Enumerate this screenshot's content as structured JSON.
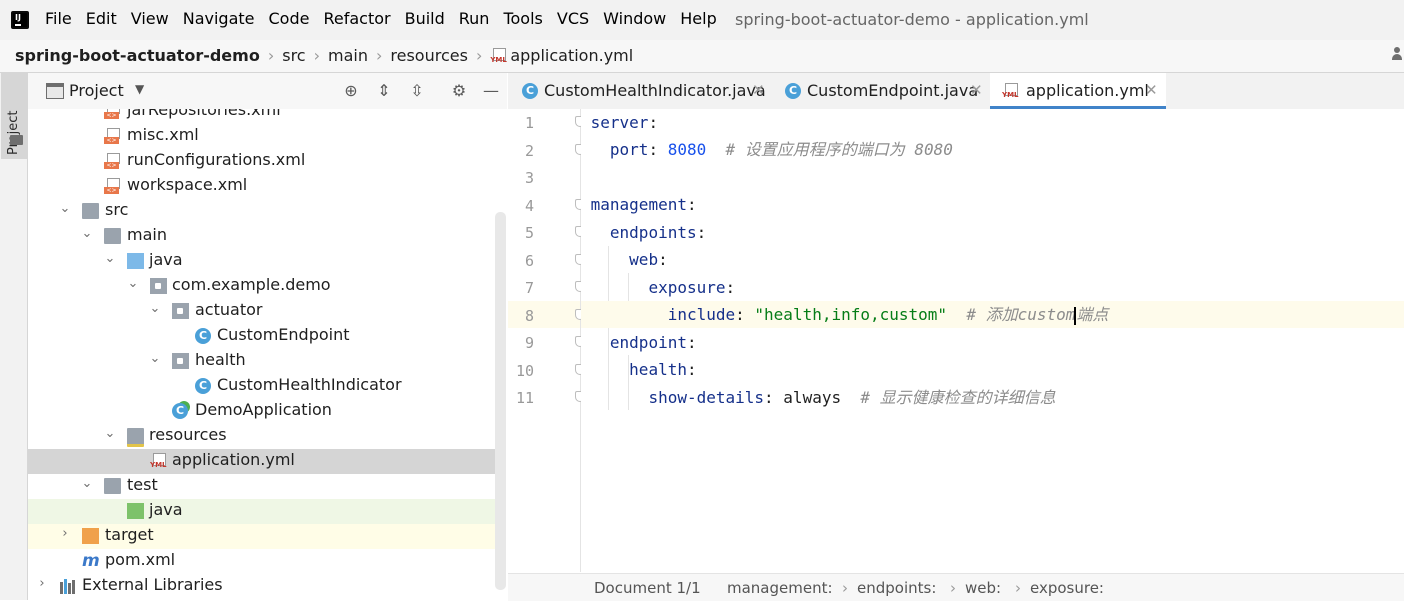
{
  "menubar": {
    "items": [
      "File",
      "Edit",
      "View",
      "Navigate",
      "Code",
      "Refactor",
      "Build",
      "Run",
      "Tools",
      "VCS",
      "Window",
      "Help"
    ],
    "window_title": "spring-boot-actuator-demo - application.yml"
  },
  "breadcrumb": {
    "project": "spring-boot-actuator-demo",
    "parts": [
      "src",
      "main",
      "resources"
    ],
    "file": "application.yml"
  },
  "toolstrip": {
    "project_tab": "Project"
  },
  "project_panel": {
    "title": "Project",
    "tree": [
      {
        "label": "jarRepositories.xml",
        "icon": "xml-file-icon"
      },
      {
        "label": "misc.xml",
        "icon": "xml-file-icon"
      },
      {
        "label": "runConfigurations.xml",
        "icon": "xml-file-icon"
      },
      {
        "label": "workspace.xml",
        "icon": "xml-file-icon"
      },
      {
        "label": "src",
        "icon": "folder-icon"
      },
      {
        "label": "main",
        "icon": "folder-icon"
      },
      {
        "label": "java",
        "icon": "source-folder-icon"
      },
      {
        "label": "com.example.demo",
        "icon": "package-icon"
      },
      {
        "label": "actuator",
        "icon": "package-icon"
      },
      {
        "label": "CustomEndpoint",
        "icon": "java-class-icon"
      },
      {
        "label": "health",
        "icon": "package-icon"
      },
      {
        "label": "CustomHealthIndicator",
        "icon": "java-class-icon"
      },
      {
        "label": "DemoApplication",
        "icon": "spring-boot-class-icon"
      },
      {
        "label": "resources",
        "icon": "resources-folder-icon"
      },
      {
        "label": "application.yml",
        "icon": "yml-file-icon"
      },
      {
        "label": "test",
        "icon": "folder-icon"
      },
      {
        "label": "java",
        "icon": "test-folder-icon"
      },
      {
        "label": "target",
        "icon": "excluded-folder-icon"
      },
      {
        "label": "pom.xml",
        "icon": "maven-icon"
      },
      {
        "label": "External Libraries",
        "icon": "libraries-icon"
      }
    ]
  },
  "editor": {
    "tabs": [
      {
        "label": "CustomHealthIndicator.java",
        "active": false
      },
      {
        "label": "CustomEndpoint.java",
        "active": false
      },
      {
        "label": "application.yml",
        "active": true
      }
    ],
    "line_numbers": [
      "1",
      "2",
      "3",
      "4",
      "5",
      "6",
      "7",
      "8",
      "9",
      "10",
      "11"
    ],
    "lines": {
      "l1_key": "server",
      "l2_key": "port",
      "l2_value": "8080",
      "l2_comment": "# 设置应用程序的端口为 8080",
      "l4_key": "management",
      "l5_key": "endpoints",
      "l6_key": "web",
      "l7_key": "exposure",
      "l8_key": "include",
      "l8_value": "\"health,info,custom\"",
      "l8_comment_a": "# 添加custom",
      "l8_comment_b": "端点",
      "l9_key": "endpoint",
      "l10_key": "health",
      "l11_key": "show-details",
      "l11_value": "always",
      "l11_comment": "# 显示健康检查的详细信息"
    },
    "current_line": 8
  },
  "statusbar": {
    "document": "Document 1/1",
    "path": [
      "management:",
      "endpoints:",
      "web:",
      "exposure:"
    ]
  }
}
